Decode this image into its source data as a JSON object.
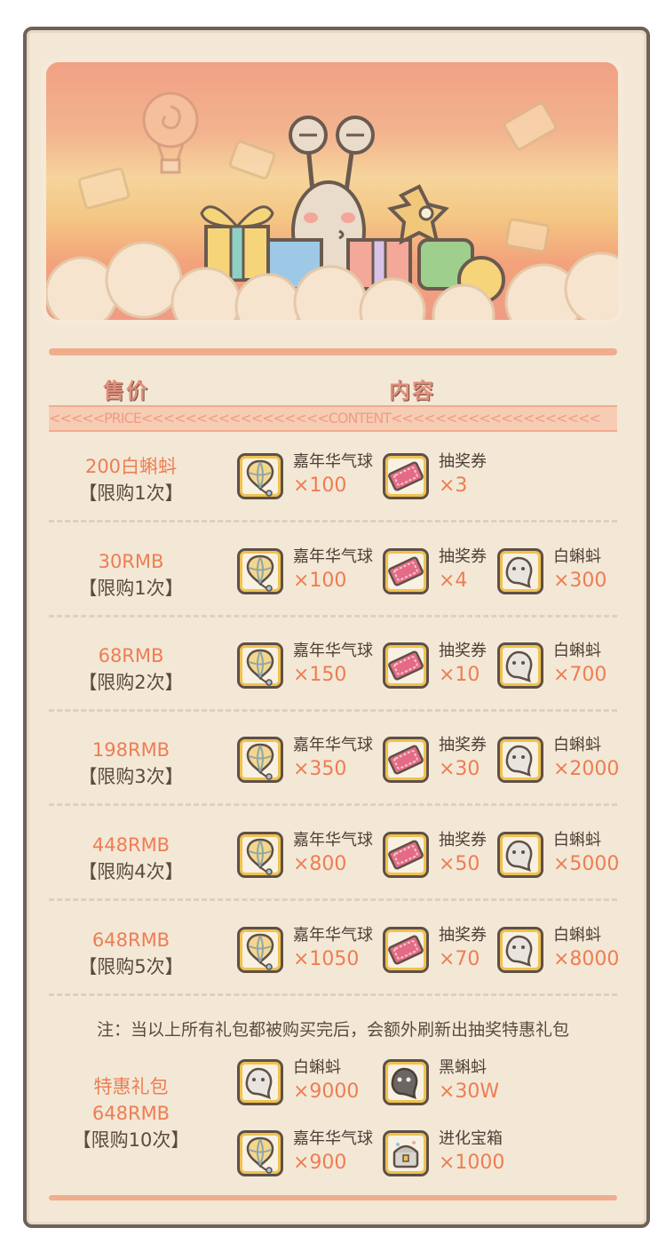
{
  "headers": {
    "price": "售价",
    "content": "内容",
    "ticker": "<<<<<PRICE<<<<<<<<<<<<<<<<<CONTENT<<<<<<<<<<<<<<<<<<<"
  },
  "rows": [
    {
      "price": "200白蝌蚪",
      "limit": "【限购1次】",
      "items": [
        {
          "icon": "balloon-icon",
          "name": "嘉年华气球",
          "qty": "×100"
        },
        {
          "icon": "ticket-icon",
          "name": "抽奖券",
          "qty": "×3"
        }
      ]
    },
    {
      "price": "30RMB",
      "limit": "【限购1次】",
      "items": [
        {
          "icon": "balloon-icon",
          "name": "嘉年华气球",
          "qty": "×100"
        },
        {
          "icon": "ticket-icon",
          "name": "抽奖券",
          "qty": "×4"
        },
        {
          "icon": "white-tadpole-icon",
          "name": "白蝌蚪",
          "qty": "×300"
        }
      ]
    },
    {
      "price": "68RMB",
      "limit": "【限购2次】",
      "items": [
        {
          "icon": "balloon-icon",
          "name": "嘉年华气球",
          "qty": "×150"
        },
        {
          "icon": "ticket-icon",
          "name": "抽奖券",
          "qty": "×10"
        },
        {
          "icon": "white-tadpole-icon",
          "name": "白蝌蚪",
          "qty": "×700"
        }
      ]
    },
    {
      "price": "198RMB",
      "limit": "【限购3次】",
      "items": [
        {
          "icon": "balloon-icon",
          "name": "嘉年华气球",
          "qty": "×350"
        },
        {
          "icon": "ticket-icon",
          "name": "抽奖券",
          "qty": "×30"
        },
        {
          "icon": "white-tadpole-icon",
          "name": "白蝌蚪",
          "qty": "×2000"
        }
      ]
    },
    {
      "price": "448RMB",
      "limit": "【限购4次】",
      "items": [
        {
          "icon": "balloon-icon",
          "name": "嘉年华气球",
          "qty": "×800"
        },
        {
          "icon": "ticket-icon",
          "name": "抽奖券",
          "qty": "×50"
        },
        {
          "icon": "white-tadpole-icon",
          "name": "白蝌蚪",
          "qty": "×5000"
        }
      ]
    },
    {
      "price": "648RMB",
      "limit": "【限购5次】",
      "items": [
        {
          "icon": "balloon-icon",
          "name": "嘉年华气球",
          "qty": "×1050"
        },
        {
          "icon": "ticket-icon",
          "name": "抽奖券",
          "qty": "×70"
        },
        {
          "icon": "white-tadpole-icon",
          "name": "白蝌蚪",
          "qty": "×8000"
        }
      ]
    }
  ],
  "note": "注：当以上所有礼包都被购买完后，会额外刷新出抽奖特惠礼包",
  "special": {
    "title": "特惠礼包",
    "price": "648RMB",
    "limit": "【限购10次】",
    "items": [
      {
        "icon": "white-tadpole-icon",
        "name": "白蝌蚪",
        "qty": "×9000"
      },
      {
        "icon": "black-tadpole-icon",
        "name": "黑蝌蚪",
        "qty": "×30W"
      },
      {
        "icon": "balloon-icon",
        "name": "嘉年华气球",
        "qty": "×900"
      },
      {
        "icon": "evolution-chest-icon",
        "name": "进化宝箱",
        "qty": "×1000"
      }
    ]
  },
  "colors": {
    "price": "#ee7d53",
    "text": "#5c4a3f",
    "accent": "#f0ad8e",
    "board": "#f3e8d6"
  }
}
